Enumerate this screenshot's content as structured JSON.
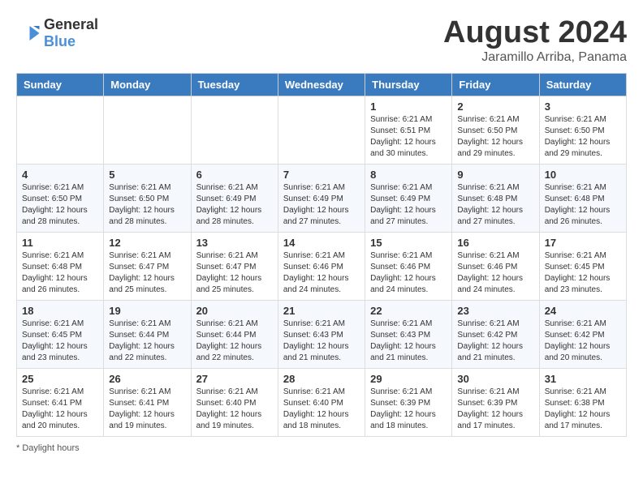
{
  "logo": {
    "text_general": "General",
    "text_blue": "Blue"
  },
  "header": {
    "month_year": "August 2024",
    "location": "Jaramillo Arriba, Panama"
  },
  "days_of_week": [
    "Sunday",
    "Monday",
    "Tuesday",
    "Wednesday",
    "Thursday",
    "Friday",
    "Saturday"
  ],
  "weeks": [
    [
      {
        "day": "",
        "info": ""
      },
      {
        "day": "",
        "info": ""
      },
      {
        "day": "",
        "info": ""
      },
      {
        "day": "",
        "info": ""
      },
      {
        "day": "1",
        "info": "Sunrise: 6:21 AM\nSunset: 6:51 PM\nDaylight: 12 hours and 30 minutes."
      },
      {
        "day": "2",
        "info": "Sunrise: 6:21 AM\nSunset: 6:50 PM\nDaylight: 12 hours and 29 minutes."
      },
      {
        "day": "3",
        "info": "Sunrise: 6:21 AM\nSunset: 6:50 PM\nDaylight: 12 hours and 29 minutes."
      }
    ],
    [
      {
        "day": "4",
        "info": "Sunrise: 6:21 AM\nSunset: 6:50 PM\nDaylight: 12 hours and 28 minutes."
      },
      {
        "day": "5",
        "info": "Sunrise: 6:21 AM\nSunset: 6:50 PM\nDaylight: 12 hours and 28 minutes."
      },
      {
        "day": "6",
        "info": "Sunrise: 6:21 AM\nSunset: 6:49 PM\nDaylight: 12 hours and 28 minutes."
      },
      {
        "day": "7",
        "info": "Sunrise: 6:21 AM\nSunset: 6:49 PM\nDaylight: 12 hours and 27 minutes."
      },
      {
        "day": "8",
        "info": "Sunrise: 6:21 AM\nSunset: 6:49 PM\nDaylight: 12 hours and 27 minutes."
      },
      {
        "day": "9",
        "info": "Sunrise: 6:21 AM\nSunset: 6:48 PM\nDaylight: 12 hours and 27 minutes."
      },
      {
        "day": "10",
        "info": "Sunrise: 6:21 AM\nSunset: 6:48 PM\nDaylight: 12 hours and 26 minutes."
      }
    ],
    [
      {
        "day": "11",
        "info": "Sunrise: 6:21 AM\nSunset: 6:48 PM\nDaylight: 12 hours and 26 minutes."
      },
      {
        "day": "12",
        "info": "Sunrise: 6:21 AM\nSunset: 6:47 PM\nDaylight: 12 hours and 25 minutes."
      },
      {
        "day": "13",
        "info": "Sunrise: 6:21 AM\nSunset: 6:47 PM\nDaylight: 12 hours and 25 minutes."
      },
      {
        "day": "14",
        "info": "Sunrise: 6:21 AM\nSunset: 6:46 PM\nDaylight: 12 hours and 24 minutes."
      },
      {
        "day": "15",
        "info": "Sunrise: 6:21 AM\nSunset: 6:46 PM\nDaylight: 12 hours and 24 minutes."
      },
      {
        "day": "16",
        "info": "Sunrise: 6:21 AM\nSunset: 6:46 PM\nDaylight: 12 hours and 24 minutes."
      },
      {
        "day": "17",
        "info": "Sunrise: 6:21 AM\nSunset: 6:45 PM\nDaylight: 12 hours and 23 minutes."
      }
    ],
    [
      {
        "day": "18",
        "info": "Sunrise: 6:21 AM\nSunset: 6:45 PM\nDaylight: 12 hours and 23 minutes."
      },
      {
        "day": "19",
        "info": "Sunrise: 6:21 AM\nSunset: 6:44 PM\nDaylight: 12 hours and 22 minutes."
      },
      {
        "day": "20",
        "info": "Sunrise: 6:21 AM\nSunset: 6:44 PM\nDaylight: 12 hours and 22 minutes."
      },
      {
        "day": "21",
        "info": "Sunrise: 6:21 AM\nSunset: 6:43 PM\nDaylight: 12 hours and 21 minutes."
      },
      {
        "day": "22",
        "info": "Sunrise: 6:21 AM\nSunset: 6:43 PM\nDaylight: 12 hours and 21 minutes."
      },
      {
        "day": "23",
        "info": "Sunrise: 6:21 AM\nSunset: 6:42 PM\nDaylight: 12 hours and 21 minutes."
      },
      {
        "day": "24",
        "info": "Sunrise: 6:21 AM\nSunset: 6:42 PM\nDaylight: 12 hours and 20 minutes."
      }
    ],
    [
      {
        "day": "25",
        "info": "Sunrise: 6:21 AM\nSunset: 6:41 PM\nDaylight: 12 hours and 20 minutes."
      },
      {
        "day": "26",
        "info": "Sunrise: 6:21 AM\nSunset: 6:41 PM\nDaylight: 12 hours and 19 minutes."
      },
      {
        "day": "27",
        "info": "Sunrise: 6:21 AM\nSunset: 6:40 PM\nDaylight: 12 hours and 19 minutes."
      },
      {
        "day": "28",
        "info": "Sunrise: 6:21 AM\nSunset: 6:40 PM\nDaylight: 12 hours and 18 minutes."
      },
      {
        "day": "29",
        "info": "Sunrise: 6:21 AM\nSunset: 6:39 PM\nDaylight: 12 hours and 18 minutes."
      },
      {
        "day": "30",
        "info": "Sunrise: 6:21 AM\nSunset: 6:39 PM\nDaylight: 12 hours and 17 minutes."
      },
      {
        "day": "31",
        "info": "Sunrise: 6:21 AM\nSunset: 6:38 PM\nDaylight: 12 hours and 17 minutes."
      }
    ]
  ],
  "footer": {
    "note": "Daylight hours"
  }
}
